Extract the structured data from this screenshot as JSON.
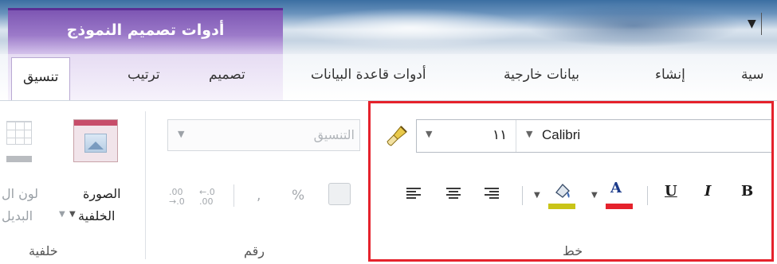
{
  "context": {
    "title": "أدوات تصميم النموذج"
  },
  "tabs": {
    "format": "تنسيق",
    "arrange": "ترتيب",
    "design": "تصميم",
    "db_tools": "أدوات قاعدة البيانات",
    "external_data": "بيانات خارجية",
    "create": "إنشاء",
    "home_partial": "سية"
  },
  "qat": {
    "customize_icon": "chevron-down-icon"
  },
  "groups": {
    "background": {
      "label": "خلفية",
      "bg_image_line1": "الصورة",
      "bg_image_line2": "الخلفية",
      "alt_color_line1": "لون ال",
      "alt_color_line2": "البديل"
    },
    "number": {
      "label": "رقم",
      "format_placeholder": "التنسيق",
      "percent": "%",
      "comma": ",",
      "inc_decimal": "←.0 .00",
      "dec_decimal": ".00 →.0"
    },
    "font": {
      "label": "خط",
      "font_name": "Calibri",
      "font_size": "١١",
      "bold": "B",
      "italic": "I",
      "underline": "U",
      "font_color_letter": "A",
      "font_color": "#e5222c",
      "fill_color": "#c9c418"
    }
  },
  "colors": {
    "context_purple": "#7d56b3",
    "highlight_red": "#e5222c"
  }
}
